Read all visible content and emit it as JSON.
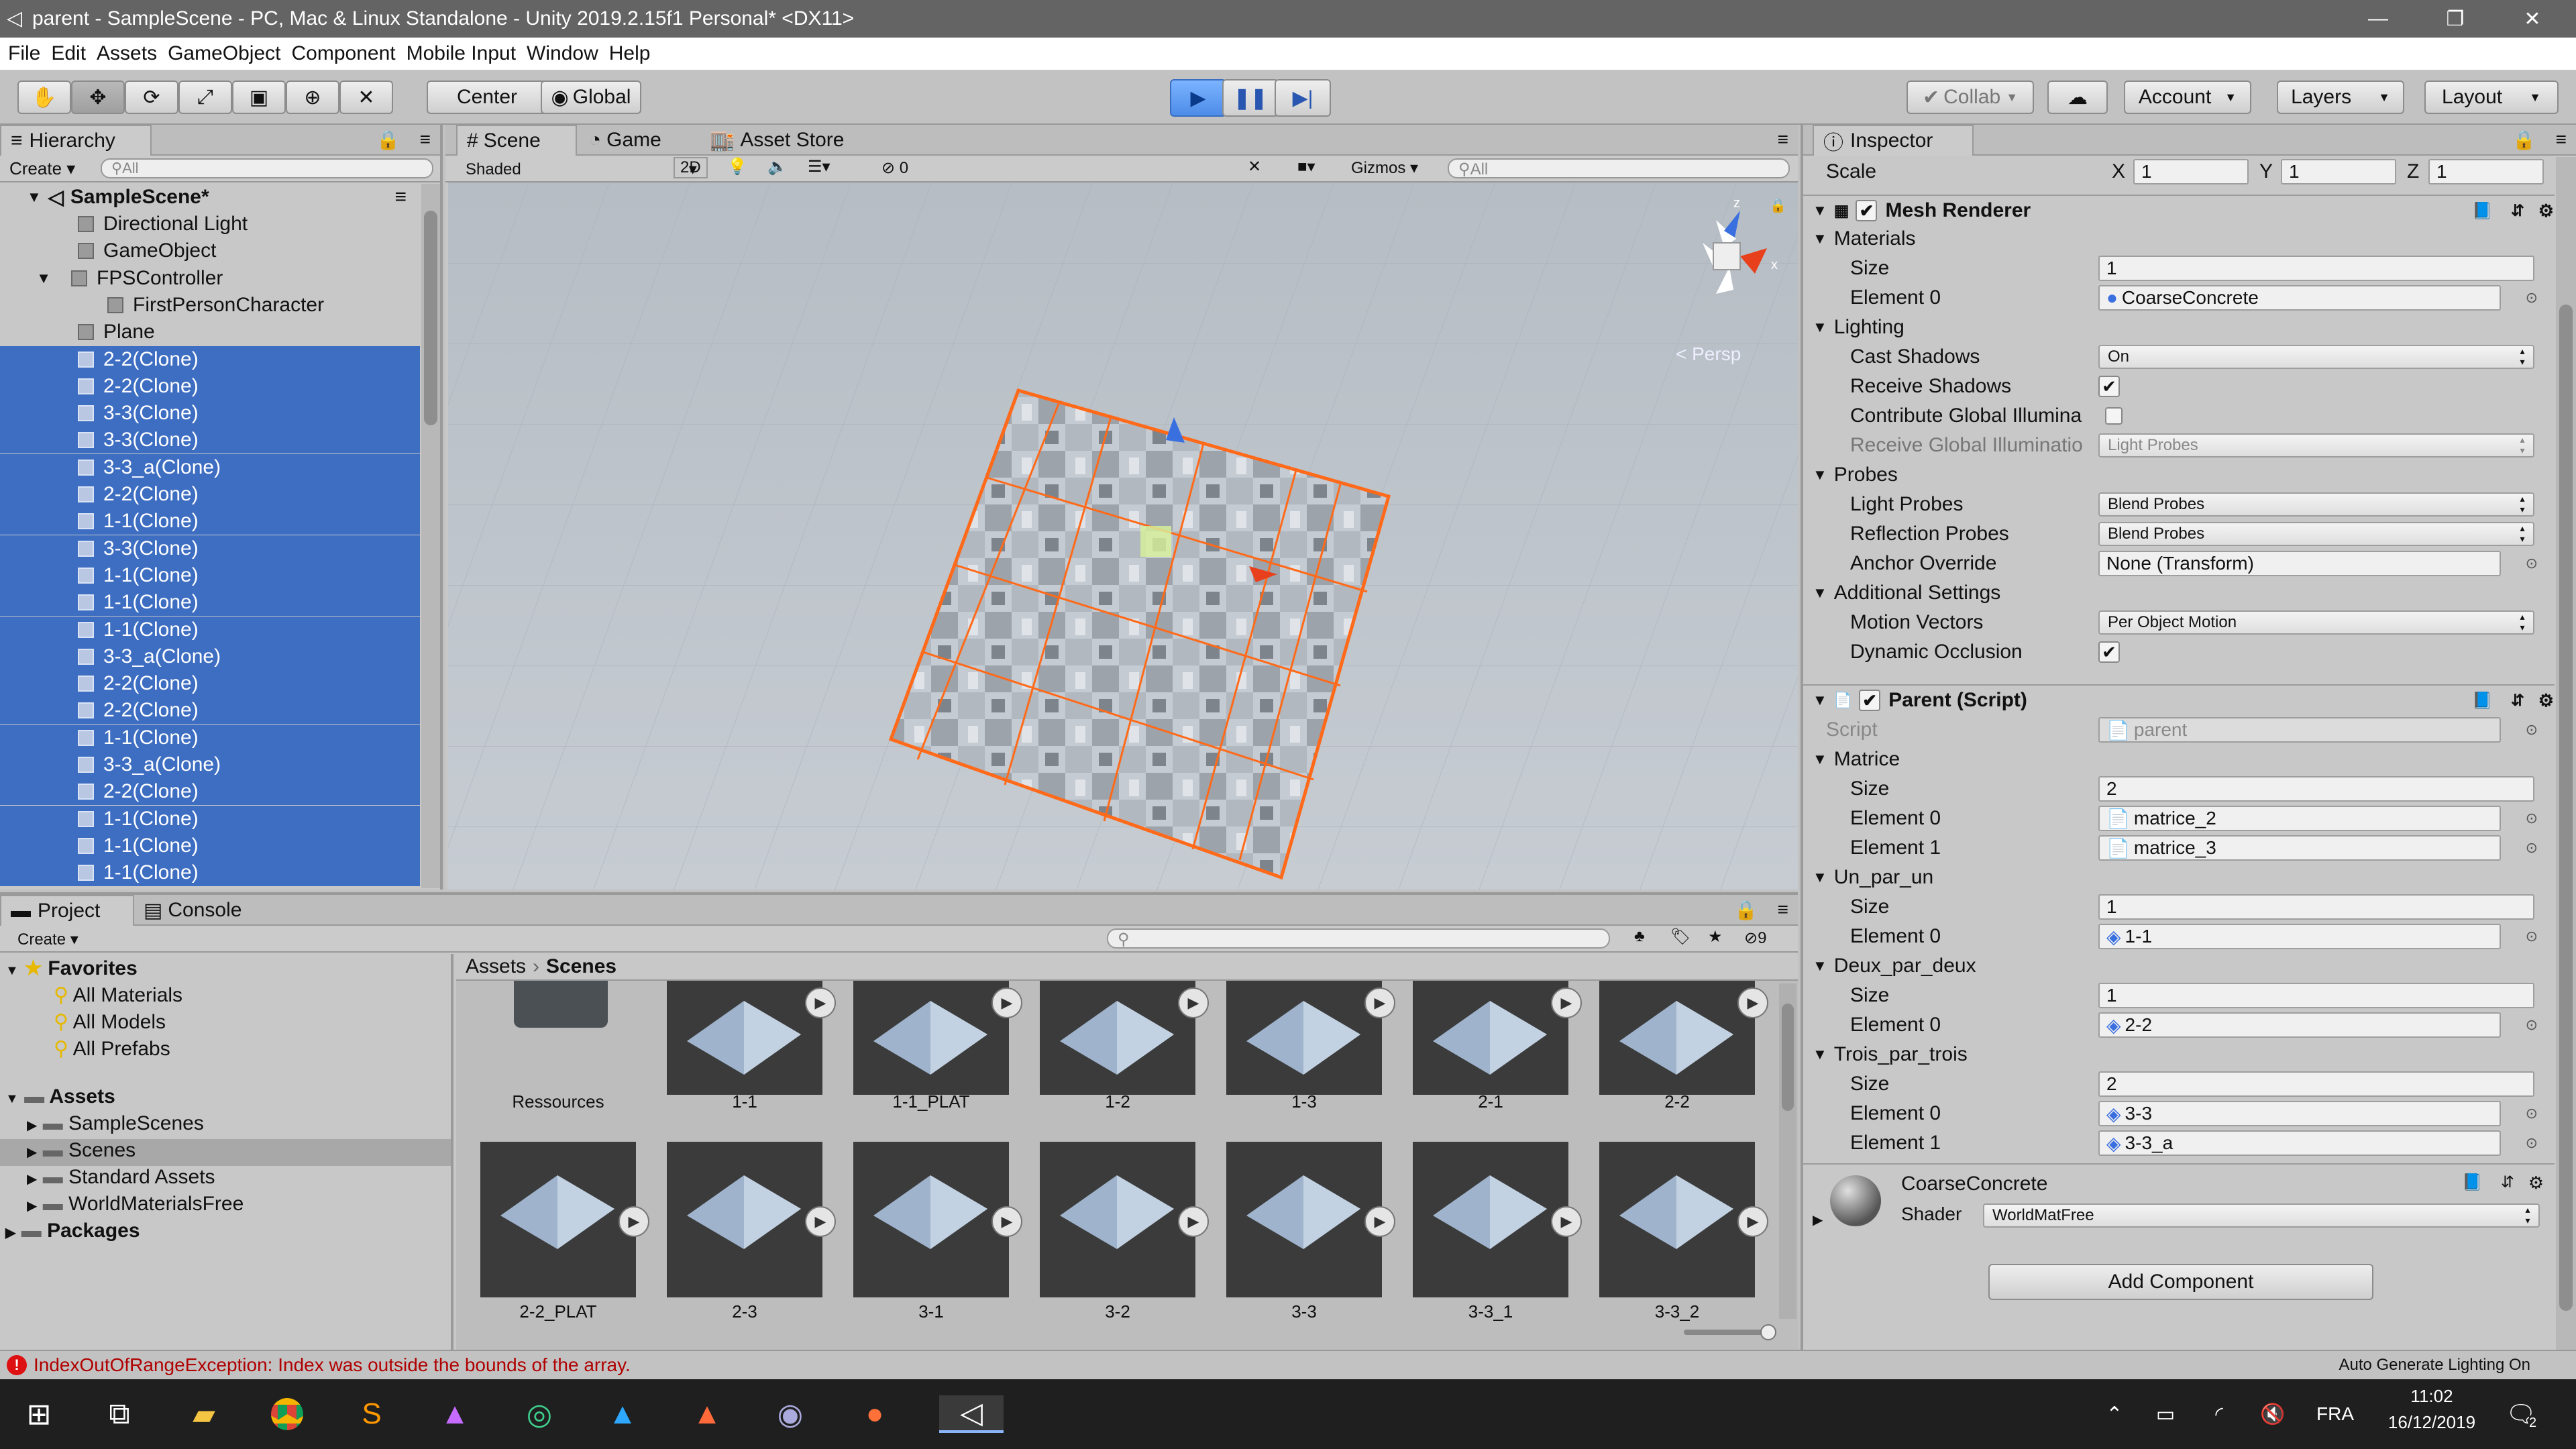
{
  "window": {
    "title": "parent - SampleScene - PC, Mac & Linux Standalone - Unity 2019.2.15f1 Personal* <DX11>",
    "minimize": "—",
    "maximize": "❐",
    "close": "✕"
  },
  "menu": [
    "File",
    "Edit",
    "Assets",
    "GameObject",
    "Component",
    "Mobile Input",
    "Window",
    "Help"
  ],
  "toolbar": {
    "tools": [
      "hand-icon",
      "move-icon",
      "rotate-icon",
      "scale-icon",
      "rect-icon",
      "transform-icon",
      "custom-tool-icon"
    ],
    "pivot": "Center",
    "space": "Global",
    "collab": "Collab",
    "account": "Account",
    "layers": "Layers",
    "layout": "Layout"
  },
  "hierarchy": {
    "tab": "Hierarchy",
    "create": "Create",
    "search": "All",
    "scene": "SampleScene*",
    "items": [
      {
        "name": "Directional Light",
        "indent": 1,
        "selected": false
      },
      {
        "name": "GameObject",
        "indent": 1,
        "selected": false
      },
      {
        "name": "FPSController",
        "indent": 1,
        "selected": false,
        "expand": true
      },
      {
        "name": "FirstPersonCharacter",
        "indent": 2,
        "selected": false
      },
      {
        "name": "Plane",
        "indent": 1,
        "selected": false
      },
      {
        "name": "2-2(Clone)",
        "indent": 1,
        "selected": true
      },
      {
        "name": "2-2(Clone)",
        "indent": 1,
        "selected": true
      },
      {
        "name": "3-3(Clone)",
        "indent": 1,
        "selected": true
      },
      {
        "name": "3-3(Clone)",
        "indent": 1,
        "selected": true
      },
      {
        "name": "3-3_a(Clone)",
        "indent": 1,
        "selected": true
      },
      {
        "name": "2-2(Clone)",
        "indent": 1,
        "selected": true
      },
      {
        "name": "1-1(Clone)",
        "indent": 1,
        "selected": true
      },
      {
        "name": "3-3(Clone)",
        "indent": 1,
        "selected": true
      },
      {
        "name": "1-1(Clone)",
        "indent": 1,
        "selected": true
      },
      {
        "name": "1-1(Clone)",
        "indent": 1,
        "selected": true
      },
      {
        "name": "1-1(Clone)",
        "indent": 1,
        "selected": true
      },
      {
        "name": "3-3_a(Clone)",
        "indent": 1,
        "selected": true
      },
      {
        "name": "2-2(Clone)",
        "indent": 1,
        "selected": true
      },
      {
        "name": "2-2(Clone)",
        "indent": 1,
        "selected": true
      },
      {
        "name": "1-1(Clone)",
        "indent": 1,
        "selected": true
      },
      {
        "name": "3-3_a(Clone)",
        "indent": 1,
        "selected": true
      },
      {
        "name": "2-2(Clone)",
        "indent": 1,
        "selected": true
      },
      {
        "name": "1-1(Clone)",
        "indent": 1,
        "selected": true
      },
      {
        "name": "1-1(Clone)",
        "indent": 1,
        "selected": true
      },
      {
        "name": "1-1(Clone)",
        "indent": 1,
        "selected": true
      }
    ]
  },
  "scene": {
    "tabs": [
      "Scene",
      "Game",
      "Asset Store"
    ],
    "shading": "Shaded",
    "mode2d": "2D",
    "hidden_count": "0",
    "gizmos": "Gizmos",
    "search": "All",
    "persp": "< Persp",
    "axis_x": "x",
    "axis_z": "z"
  },
  "inspector": {
    "tab": "Inspector",
    "scale": {
      "label": "Scale",
      "x_label": "X",
      "x": "1",
      "y_label": "Y",
      "y": "1",
      "z_label": "Z",
      "z": "1"
    },
    "mesh_renderer": {
      "title": "Mesh Renderer",
      "materials": "Materials",
      "size_label": "Size",
      "size": "1",
      "element0_label": "Element 0",
      "element0": "CoarseConcrete",
      "lighting": "Lighting",
      "cast_shadows_label": "Cast Shadows",
      "cast_shadows": "On",
      "receive_shadows_label": "Receive Shadows",
      "contribute_gi_label": "Contribute Global Illumina",
      "receive_gi_label": "Receive Global Illuminatio",
      "receive_gi": "Light Probes",
      "probes": "Probes",
      "light_probes_label": "Light Probes",
      "light_probes": "Blend Probes",
      "reflection_probes_label": "Reflection Probes",
      "reflection_probes": "Blend Probes",
      "anchor_label": "Anchor Override",
      "anchor": "None (Transform)",
      "additional": "Additional Settings",
      "motion_label": "Motion Vectors",
      "motion": "Per Object Motion",
      "dynamic_occ_label": "Dynamic Occlusion"
    },
    "parent_script": {
      "title": "Parent (Script)",
      "script_label": "Script",
      "script": "parent",
      "matrice": "Matrice",
      "matrice_size": "2",
      "matrice_e0": "matrice_2",
      "matrice_e1": "matrice_3",
      "un": "Un_par_un",
      "un_size": "1",
      "un_e0": "1-1",
      "deux": "Deux_par_deux",
      "deux_size": "1",
      "deux_e0": "2-2",
      "trois": "Trois_par_trois",
      "trois_size": "2",
      "trois_e0": "3-3",
      "trois_e1": "3-3_a",
      "size_label": "Size",
      "e0_label": "Element 0",
      "e1_label": "Element 1"
    },
    "material": {
      "name": "CoarseConcrete",
      "shader_label": "Shader",
      "shader": "WorldMatFree"
    },
    "add_component": "Add Component"
  },
  "project": {
    "tabs": [
      "Project",
      "Console"
    ],
    "create": "Create",
    "hidden_count": "9",
    "favorites": "Favorites",
    "fav_items": [
      "All Materials",
      "All Models",
      "All Prefabs"
    ],
    "assets": "Assets",
    "asset_folders": [
      "SampleScenes",
      "Scenes",
      "Standard Assets",
      "WorldMaterialsFree"
    ],
    "packages": "Packages",
    "breadcrumb_root": "Assets",
    "breadcrumb_current": "Scenes",
    "grid_row1": [
      "Ressources",
      "1-1",
      "1-1_PLAT",
      "1-2",
      "1-3",
      "2-1",
      "2-2"
    ],
    "grid_row2": [
      "2-2_PLAT",
      "2-3",
      "3-1",
      "3-2",
      "3-3",
      "3-3_1",
      "3-3_2"
    ]
  },
  "status": {
    "error": "IndexOutOfRangeException: Index was outside the bounds of the array.",
    "right": "Auto Generate Lighting On"
  },
  "taskbar": {
    "lang": "FRA",
    "time": "11:02",
    "date": "16/12/2019",
    "notif": "2"
  }
}
